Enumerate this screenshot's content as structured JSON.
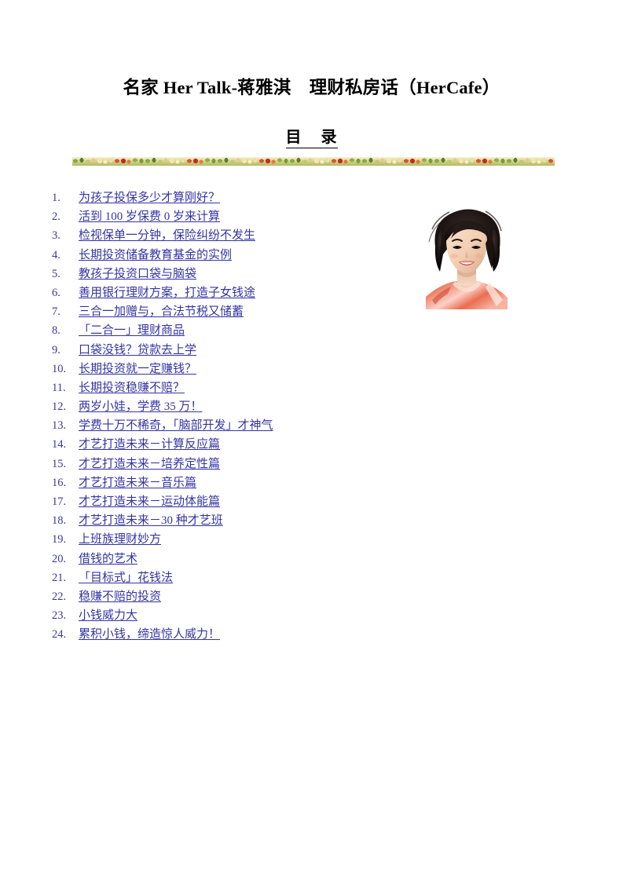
{
  "document": {
    "title": "名家 Her Talk-蒋雅淇    理财私房话（HerCafe）",
    "toc_heading": "目    录",
    "accent_link_color": "#3434a4",
    "number_color": "#3a3a9c",
    "page_background": "#ffffff"
  },
  "decoration": {
    "border_name": "floral-confetti-divider",
    "colors": [
      "#7fa83c",
      "#4e7a22",
      "#b8c96a",
      "#e0c98a",
      "#f2e7a8",
      "#d84b2a",
      "#c2201b",
      "#e2702c",
      "#8bad3e",
      "#6d9a2c"
    ]
  },
  "portrait": {
    "alt": "蒋雅淇 portrait photograph",
    "hair_color": "#1a1413",
    "skin_color": "#f3d3bd",
    "garment_color": "#e8694f"
  },
  "toc": {
    "items": [
      {
        "num": "1.",
        "label": "为孩子投保多少才算刚好？"
      },
      {
        "num": "2.",
        "label": "活到 100 岁保费 0 岁来计算"
      },
      {
        "num": "3.",
        "label": "检视保单一分钟，保险纠纷不发生"
      },
      {
        "num": "4.",
        "label": "长期投资储备教育基金的实例"
      },
      {
        "num": "5.",
        "label": "教孩子投资口袋与脑袋"
      },
      {
        "num": "6.",
        "label": "善用银行理财方案，打造子女钱途"
      },
      {
        "num": "7.",
        "label": "三合一加赠与，合法节税又储蓄"
      },
      {
        "num": "8.",
        "label": "「二合一」理财商品"
      },
      {
        "num": "9.",
        "label": "口袋没钱？贷款去上学"
      },
      {
        "num": "10.",
        "label": "长期投资就一定赚钱？"
      },
      {
        "num": "11.",
        "label": "长期投资稳赚不赔？"
      },
      {
        "num": "12.",
        "label": "两岁小娃，学费 35 万！"
      },
      {
        "num": "13.",
        "label": "学费十万不稀奇，「脑部开发」才神气"
      },
      {
        "num": "14.",
        "label": "才艺打造未来－计算反应篇"
      },
      {
        "num": "15.",
        "label": "才艺打造未来－培养定性篇"
      },
      {
        "num": "16.",
        "label": "才艺打造未来－音乐篇"
      },
      {
        "num": "17.",
        "label": "才艺打造未来－运动体能篇"
      },
      {
        "num": "18.",
        "label": "才艺打造未来－30 种才艺班"
      },
      {
        "num": "19.",
        "label": "上班族理财妙方"
      },
      {
        "num": "20.",
        "label": "借钱的艺术"
      },
      {
        "num": "21.",
        "label": "「目标式」花钱法"
      },
      {
        "num": "22.",
        "label": "稳赚不赔的投资"
      },
      {
        "num": "23.",
        "label": "小钱威力大"
      },
      {
        "num": "24.",
        "label": "累积小钱，缔造惊人威力！"
      }
    ]
  }
}
